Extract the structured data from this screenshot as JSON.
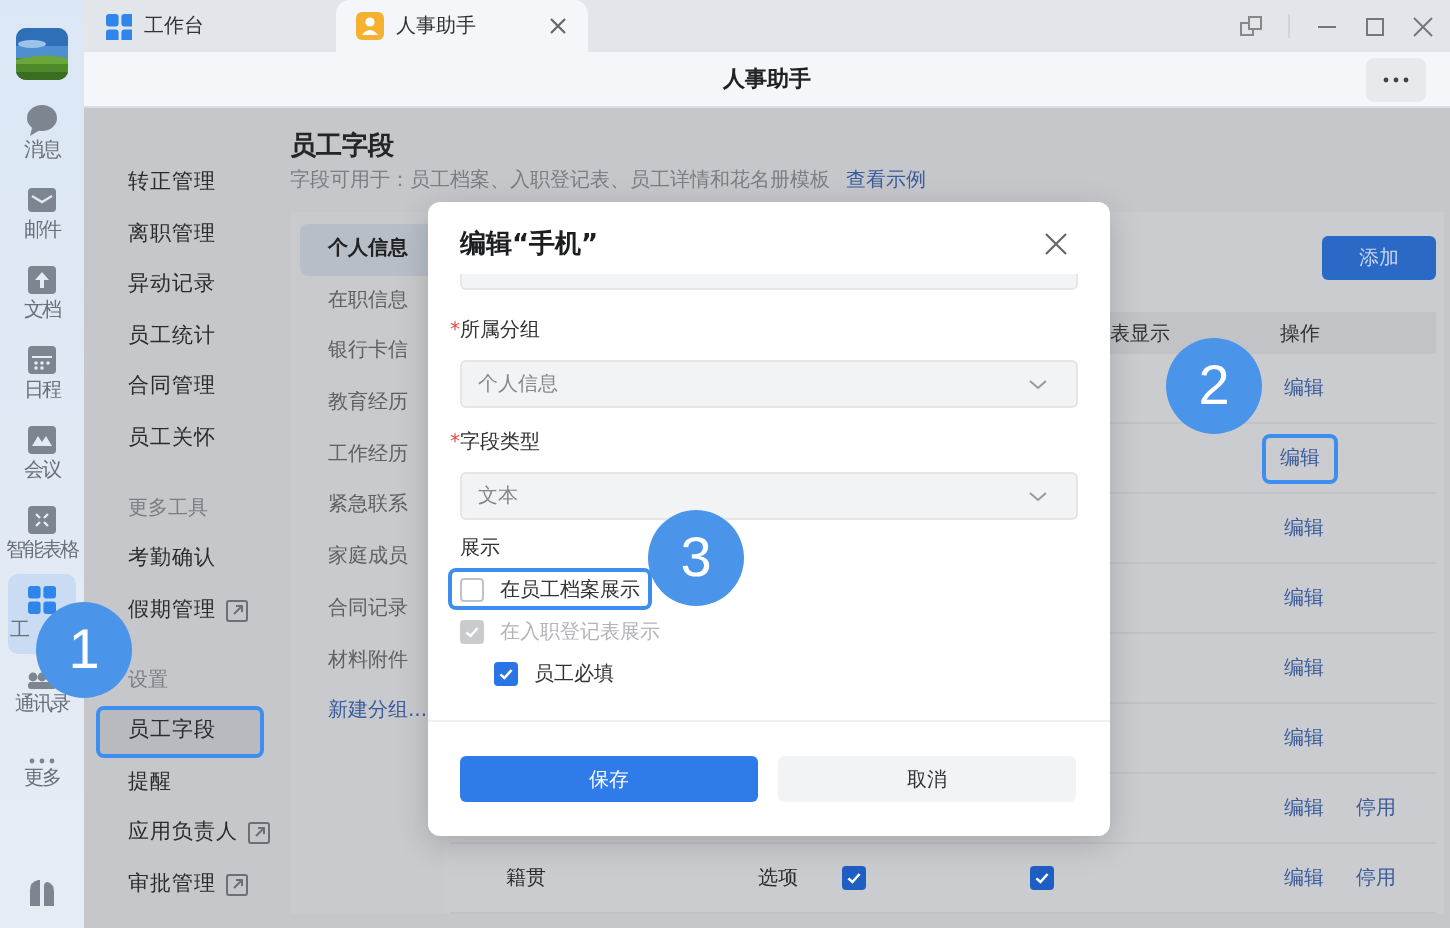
{
  "tabs": [
    {
      "label": "工作台",
      "selected": false,
      "closable": false
    },
    {
      "label": "人事助手",
      "selected": true,
      "closable": true
    }
  ],
  "header": {
    "title": "人事助手"
  },
  "rail": {
    "items": [
      {
        "label": "消息",
        "selected": false
      },
      {
        "label": "邮件",
        "selected": false
      },
      {
        "label": "文档",
        "selected": false
      },
      {
        "label": "日程",
        "selected": false
      },
      {
        "label": "会议",
        "selected": false
      },
      {
        "label": "智能表格",
        "selected": false
      },
      {
        "label": "工",
        "selected": true
      },
      {
        "label": "通讯录",
        "selected": false
      },
      {
        "label": "更多",
        "selected": false
      }
    ]
  },
  "nav": {
    "items": [
      {
        "kind": "item",
        "label": "转正管理",
        "selected": false,
        "highlighted": false,
        "external": false
      },
      {
        "kind": "item",
        "label": "离职管理",
        "selected": false,
        "highlighted": false,
        "external": false
      },
      {
        "kind": "item",
        "label": "异动记录",
        "selected": false,
        "highlighted": false,
        "external": false
      },
      {
        "kind": "item",
        "label": "员工统计",
        "selected": false,
        "highlighted": false,
        "external": false
      },
      {
        "kind": "item",
        "label": "合同管理",
        "selected": false,
        "highlighted": false,
        "external": false
      },
      {
        "kind": "item",
        "label": "员工关怀",
        "selected": false,
        "highlighted": false,
        "external": false
      },
      {
        "kind": "section",
        "label": "更多工具"
      },
      {
        "kind": "item",
        "label": "考勤确认",
        "selected": false,
        "highlighted": false,
        "external": false
      },
      {
        "kind": "item",
        "label": "假期管理",
        "selected": false,
        "highlighted": false,
        "external": true
      },
      {
        "kind": "section",
        "label": "设置"
      },
      {
        "kind": "item",
        "label": "员工字段",
        "selected": true,
        "highlighted": true,
        "external": false
      },
      {
        "kind": "item",
        "label": "提醒",
        "selected": false,
        "highlighted": false,
        "external": false
      },
      {
        "kind": "item",
        "label": "应用负责人",
        "selected": false,
        "highlighted": false,
        "external": true
      },
      {
        "kind": "item",
        "label": "审批管理",
        "selected": false,
        "highlighted": false,
        "external": true
      }
    ]
  },
  "page": {
    "title": "员工字段",
    "description": "字段可用于：员工档案、入职登记表、员工详情和花名册模板",
    "link": "查看示例"
  },
  "groups": {
    "items": [
      {
        "label": "个人信息",
        "selected": true
      },
      {
        "label": "在职信息",
        "selected": false
      },
      {
        "label": "银行卡信",
        "selected": false
      },
      {
        "label": "教育经历",
        "selected": false
      },
      {
        "label": "工作经历",
        "selected": false
      },
      {
        "label": "紧急联系",
        "selected": false
      },
      {
        "label": "家庭成员",
        "selected": false
      },
      {
        "label": "合同记录",
        "selected": false
      },
      {
        "label": "材料附件",
        "selected": false
      }
    ],
    "new_group": "新建分组..."
  },
  "add_button": "添加",
  "table": {
    "columns": [
      {
        "label": "表显示"
      },
      {
        "label": "操作"
      }
    ],
    "rows": [
      {
        "actions": [
          {
            "label": "编辑",
            "highlighted": false
          }
        ]
      },
      {
        "actions": [
          {
            "label": "编辑",
            "highlighted": true
          }
        ]
      },
      {
        "actions": [
          {
            "label": "编辑",
            "highlighted": false
          }
        ]
      },
      {
        "actions": [
          {
            "label": "编辑",
            "highlighted": false
          }
        ]
      },
      {
        "actions": [
          {
            "label": "编辑",
            "highlighted": false
          }
        ]
      },
      {
        "actions": [
          {
            "label": "编辑",
            "highlighted": false
          }
        ]
      },
      {
        "actions": [
          {
            "label": "编辑",
            "highlighted": false
          },
          {
            "label": "停用",
            "highlighted": false
          }
        ]
      },
      {
        "field": "籍贯",
        "type": "选项",
        "show_archive": true,
        "show_entry": true,
        "actions": [
          {
            "label": "编辑",
            "highlighted": false
          },
          {
            "label": "停用",
            "highlighted": false
          }
        ]
      }
    ]
  },
  "dialog": {
    "title": "编辑“手机”",
    "fields": [
      {
        "mark": "*",
        "label": "所属分组",
        "value": "个人信息"
      },
      {
        "mark": "*",
        "label": "字段类型",
        "value": "文本"
      }
    ],
    "display_label": "展示",
    "options": [
      {
        "label": "在员工档案展示",
        "checked": false,
        "disabled": false,
        "highlighted": true,
        "indented": false
      },
      {
        "label": "在入职登记表展示",
        "checked": true,
        "disabled": true,
        "highlighted": false,
        "indented": false
      },
      {
        "label": "员工必填",
        "checked": true,
        "disabled": false,
        "highlighted": false,
        "indented": true
      }
    ],
    "buttons": [
      {
        "label": "保存",
        "kind": "primary"
      },
      {
        "label": "取消",
        "kind": "secondary"
      }
    ]
  },
  "callouts": [
    {
      "label": "1"
    },
    {
      "label": "2"
    },
    {
      "label": "3"
    }
  ]
}
